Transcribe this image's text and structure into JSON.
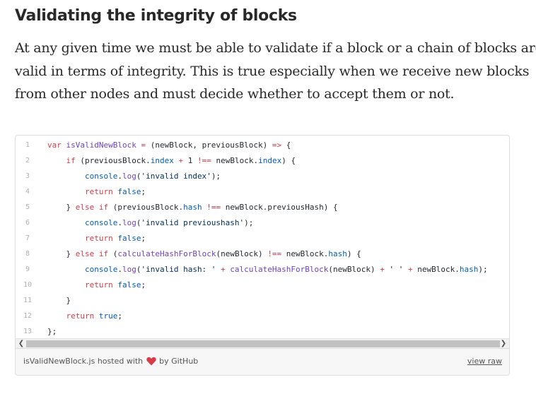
{
  "heading": "Validating the integrity of blocks",
  "paragraph_lines": [
    "At any given time we must be able to validate if a block or a chain of blocks are",
    "valid in terms of integrity. This is true especially when we receive new blocks",
    "from other nodes and must decide whether to accept them or not."
  ],
  "gist": {
    "filename": "isValidNewBlock.js",
    "hosted_with": "hosted with",
    "by": "by GitHub",
    "view_raw": "view raw",
    "heart_color": "#d73a49",
    "lines": [
      {
        "num": "1",
        "code": "var isValidNewBlock = (newBlock, previousBlock) => {"
      },
      {
        "num": "2",
        "code": "    if (previousBlock.index + 1 !== newBlock.index) {"
      },
      {
        "num": "3",
        "code": "        console.log('invalid index');"
      },
      {
        "num": "4",
        "code": "        return false;"
      },
      {
        "num": "5",
        "code": "    } else if (previousBlock.hash !== newBlock.previousHash) {"
      },
      {
        "num": "6",
        "code": "        console.log('invalid previoushash');"
      },
      {
        "num": "7",
        "code": "        return false;"
      },
      {
        "num": "8",
        "code": "    } else if (calculateHashForBlock(newBlock) !== newBlock.hash) {"
      },
      {
        "num": "9",
        "code": "        console.log('invalid hash: ' + calculateHashForBlock(newBlock) + ' ' + newBlock.hash);"
      },
      {
        "num": "10",
        "code": "        return false;"
      },
      {
        "num": "11",
        "code": "    }"
      },
      {
        "num": "12",
        "code": "    return true;"
      },
      {
        "num": "13",
        "code": "};"
      }
    ]
  },
  "scroll_left_icon": "chevron-left-icon",
  "scroll_right_icon": "chevron-right-icon"
}
